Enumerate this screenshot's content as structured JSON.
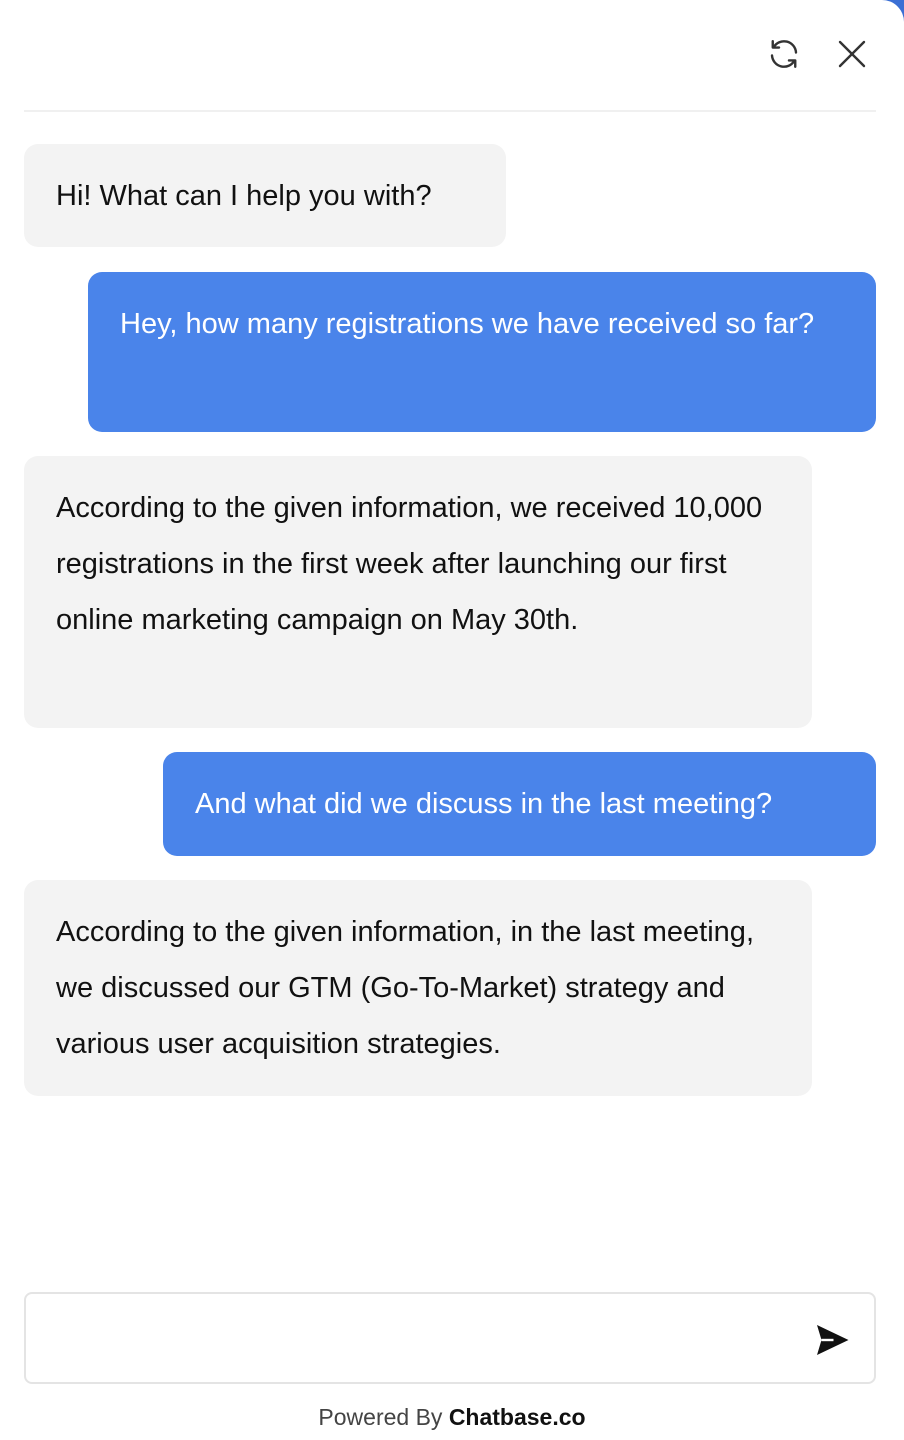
{
  "header": {
    "refresh_icon": "refresh-icon",
    "close_icon": "close-icon"
  },
  "messages": [
    {
      "role": "bot",
      "text": "Hi! What can I help you with?"
    },
    {
      "role": "user",
      "text": "Hey, how many registrations we have received so far?"
    },
    {
      "role": "bot",
      "text": "According to the given information, we received 10,000 registrations in the first week after launching our first online marketing campaign on May 30th."
    },
    {
      "role": "user",
      "text": "And what did we discuss in the last meeting?"
    },
    {
      "role": "bot",
      "text": "According to the given information, in the last meeting, we discussed our GTM (Go-To-Market) strategy and various user acquisition strategies."
    }
  ],
  "composer": {
    "value": "",
    "placeholder": "",
    "send_icon": "send-icon"
  },
  "footer": {
    "prefix": "Powered By",
    "brand": "Chatbase.co"
  },
  "colors": {
    "user_bubble": "#4a84ea",
    "bot_bubble": "#f3f3f3",
    "page_edge": "#3b6fd4"
  }
}
